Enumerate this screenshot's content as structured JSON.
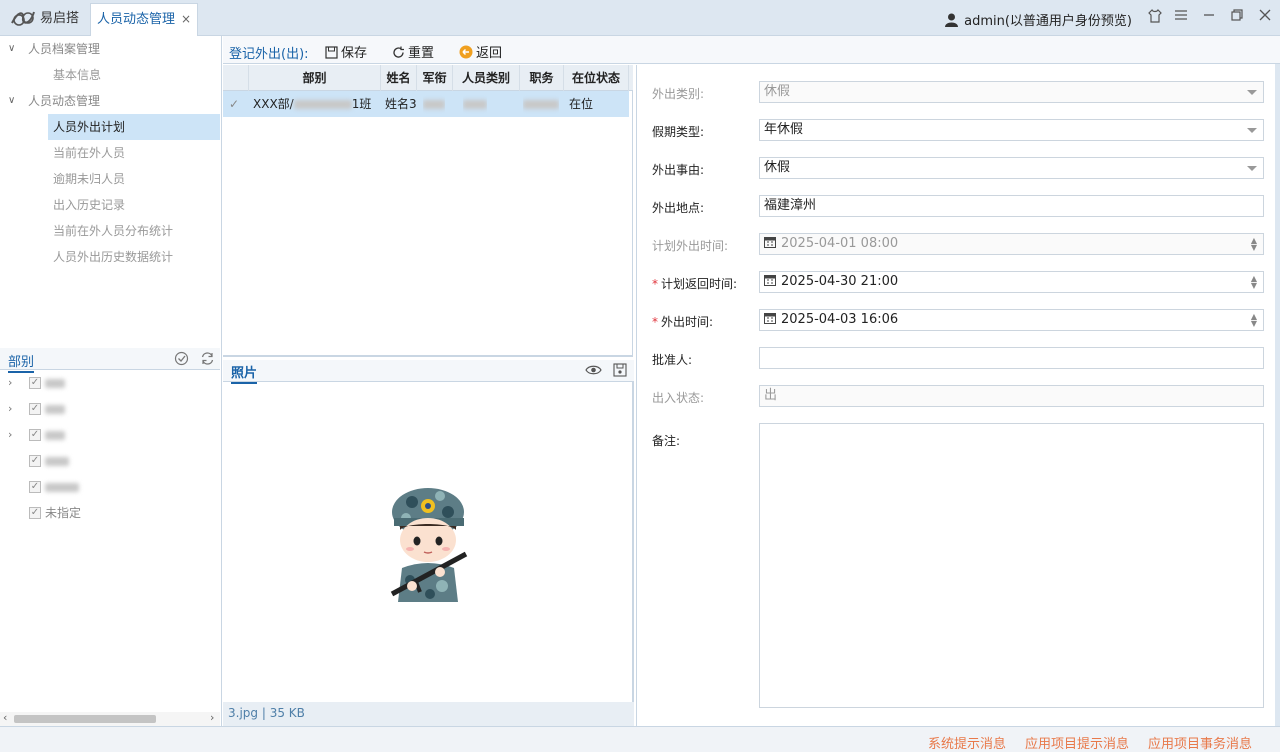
{
  "app": {
    "title": "易启搭"
  },
  "tabs": {
    "active_label": "人员动态管理",
    "close_glyph": "×"
  },
  "user": {
    "label": "admin(以普通用户身份预览)"
  },
  "nav": {
    "group1": "人员档案管理",
    "group1_items": [
      "基本信息"
    ],
    "group2": "人员动态管理",
    "group2_items": [
      "人员外出计划",
      "当前在外人员",
      "逾期未归人员",
      "出入历史记录",
      "当前在外人员分布统计",
      "人员外出历史数据统计"
    ]
  },
  "dept": {
    "title": "部别",
    "last_item": "未指定"
  },
  "toolbar": {
    "title": "登记外出(出):",
    "save": "保存",
    "reset": "重置",
    "back": "返回"
  },
  "grid": {
    "columns": [
      "部别",
      "姓名",
      "军衔",
      "人员类别",
      "职务",
      "在位状态"
    ],
    "row": {
      "dept_prefix": "XXX部/",
      "dept_suffix": "1班",
      "name": "姓名3",
      "status": "在位"
    }
  },
  "photo": {
    "title": "照片",
    "file_info": "3.jpg | 35 KB"
  },
  "form": {
    "out_type_label": "外出类别:",
    "out_type_value": "休假",
    "leave_type_label": "假期类型:",
    "leave_type_value": "年休假",
    "reason_label": "外出事由:",
    "reason_value": "休假",
    "place_label": "外出地点:",
    "place_value": "福建漳州",
    "plan_out_label": "计划外出时间:",
    "plan_out_value": "2025-04-01 08:00",
    "plan_return_label": "计划返回时间:",
    "plan_return_value": "2025-04-30 21:00",
    "out_time_label": "外出时间:",
    "out_time_value": "2025-04-03 16:06",
    "approver_label": "批准人:",
    "approver_value": "",
    "io_status_label": "出入状态:",
    "io_status_value": "出",
    "remark_label": "备注:",
    "required_mark": "*"
  },
  "status_bar": {
    "msg1": "系统提示消息",
    "msg2": "应用项目提示消息",
    "msg3": "应用项目事务消息"
  }
}
